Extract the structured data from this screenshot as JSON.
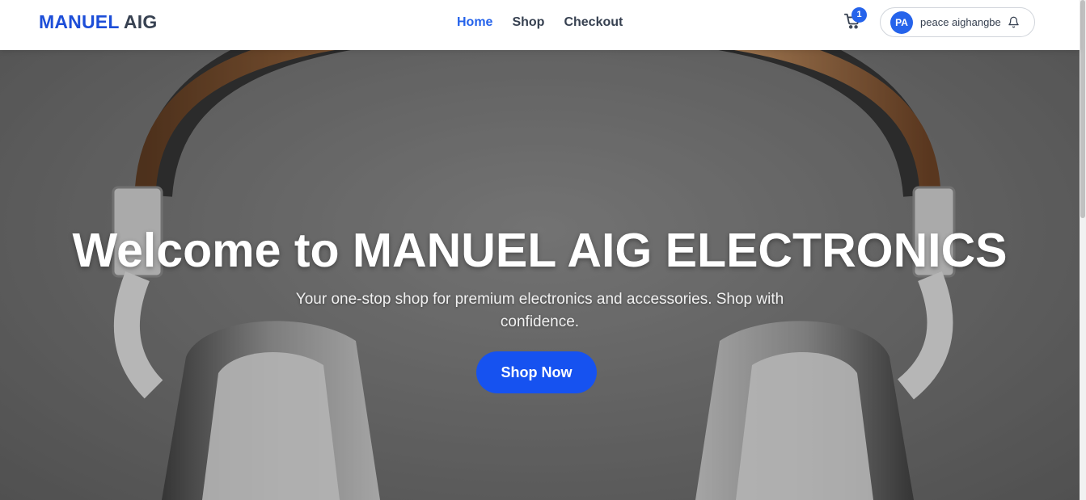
{
  "navbar": {
    "brand_part1": "MANUEL",
    "brand_part2": "AIG",
    "links": [
      {
        "label": "Home",
        "active": true
      },
      {
        "label": "Shop",
        "active": false
      },
      {
        "label": "Checkout",
        "active": false
      }
    ],
    "cart_count": "1",
    "user": {
      "initials": "PA",
      "name": "peace aighangbe"
    }
  },
  "hero": {
    "title": "Welcome to MANUEL AIG ELECTRONICS",
    "subtitle": "Your one-stop shop for premium electronics and accessories. Shop with confidence.",
    "cta_label": "Shop Now"
  },
  "icons": {
    "cart": "cart-icon",
    "bell": "bell-icon"
  },
  "colors": {
    "brand_blue": "#1d4ed8",
    "accent": "#2563eb",
    "button": "#1652f0",
    "text_dark": "#374151"
  }
}
